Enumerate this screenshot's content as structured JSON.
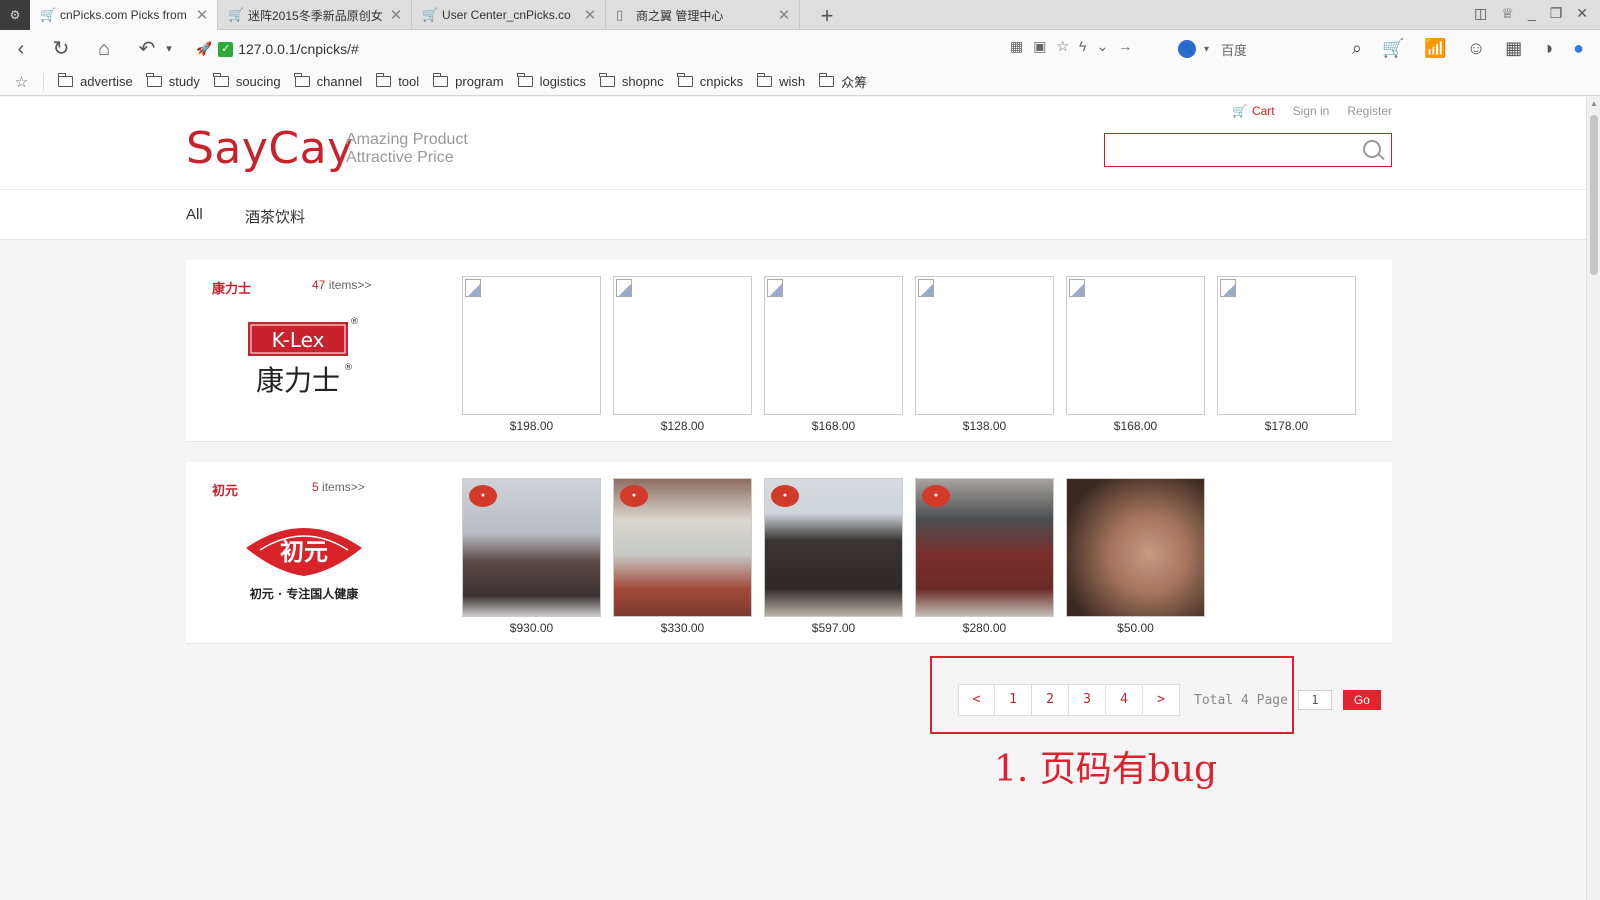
{
  "browser": {
    "tabs": [
      {
        "title": "cnPicks.com Picks from",
        "active": true
      },
      {
        "title": "迷阵2015冬季新品原创女",
        "active": false
      },
      {
        "title": "User Center_cnPicks.co",
        "active": false
      },
      {
        "title": "商之翼 管理中心",
        "active": false
      }
    ],
    "url": "127.0.0.1/cnpicks/#",
    "search_engine": "百度",
    "bookmarks": [
      "advertise",
      "study",
      "soucing",
      "channel",
      "tool",
      "program",
      "logistics",
      "shopnc",
      "cnpicks",
      "wish",
      "众筹"
    ]
  },
  "site": {
    "toplinks": {
      "cart": "Cart",
      "signin": "Sign in",
      "register": "Register"
    },
    "logo": "SayCay",
    "slogan_line1": "Amazing Product",
    "slogan_line2": "Attractive Price",
    "search_value": "",
    "nav": [
      "All",
      "酒茶饮料"
    ]
  },
  "brands": [
    {
      "name": "康力士",
      "count": "47",
      "count_suffix": "items>>",
      "logo_text": "K-Lex",
      "logo_sub": "康力士",
      "products": [
        {
          "price": "$198.00"
        },
        {
          "price": "$128.00"
        },
        {
          "price": "$168.00"
        },
        {
          "price": "$138.00"
        },
        {
          "price": "$168.00"
        },
        {
          "price": "$178.00"
        }
      ]
    },
    {
      "name": "初元",
      "count": "5",
      "count_suffix": "items>>",
      "logo_text": "初元",
      "logo_sub": "初元 · 专注国人健康",
      "products": [
        {
          "price": "$930.00"
        },
        {
          "price": "$330.00"
        },
        {
          "price": "$597.00"
        },
        {
          "price": "$280.00"
        },
        {
          "price": "$50.00"
        }
      ]
    }
  ],
  "pager": {
    "prev": "<",
    "pages": [
      "1",
      "2",
      "3",
      "4"
    ],
    "next": ">",
    "total": "Total 4 Page",
    "input_value": "1",
    "go": "Go"
  },
  "annotation": "1. 页码有bug",
  "colors": {
    "brand_red": "#c8232c",
    "annotation_red": "#e0202c"
  }
}
